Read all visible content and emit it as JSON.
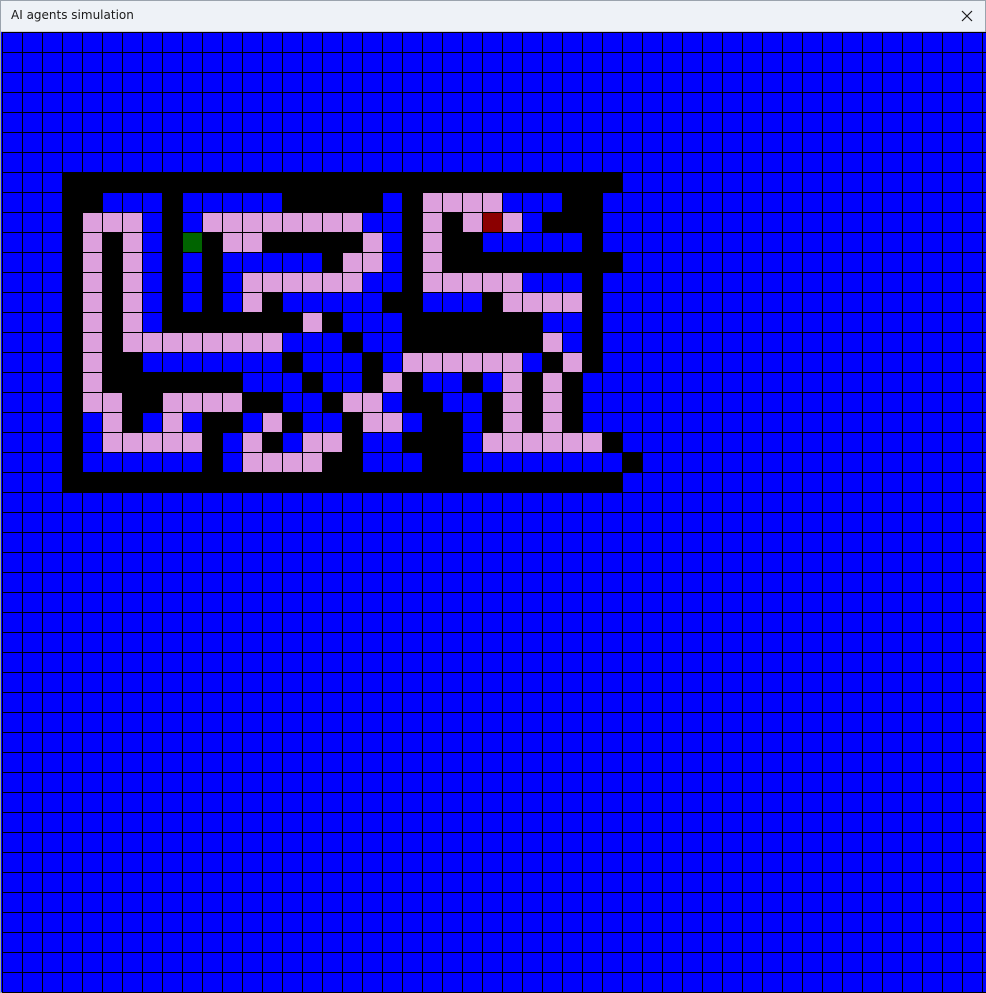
{
  "window": {
    "title": "AI agents simulation",
    "close_icon": "close-x-icon"
  },
  "colors": {
    "empty": "#0000ff",
    "wall": "#000000",
    "path": "#dda0dd",
    "start": "#006400",
    "goal": "#8b0000",
    "gridline": "#000000"
  },
  "maze": {
    "legend": {
      "#": "wall",
      ".": "empty",
      "p": "path",
      "S": "start",
      "G": "goal"
    },
    "rows": [
      "..................................................",
      "..................................................",
      "..................................................",
      "..................................................",
      "..................................................",
      "..................................................",
      "..................................................",
      "...############################...................",
      "...##...#.....#####.#pppp...##...................",
      "...#ppp.#.pppppppp..#p#pGp.###...................",
      "...#p#p.#S#pp#####p.#p##.....#...................",
      "...#p#p.#.#.....#pp.#p#########...................",
      "...#p#p.#.#.pppppp..#ppppp...#...................",
      "...#p#p.#.#.p#.....##...#pppp#...................",
      "...#p#p.#######p#...#######..#...................",
      "...#p#pppppppp...#..#######p.#...................",
      "...#p##.......#...#.pppppp.#p#...................",
      "...#p#######...#..#p#..#.p#p#...................",
      "...#pp##pppp##..#pp.##..#p#p#...................",
      "...#.p#.p.##.p#..#pp.##.#p#p#...................",
      "...#.ppppp#.p#.pp#..###.pppppp#...................",
      "...#......#.pppp##...##........#...................",
      "...############################...................",
      "..................................................",
      "..................................................",
      "..................................................",
      "..................................................",
      "..................................................",
      "..................................................",
      "..................................................",
      "..................................................",
      "..................................................",
      "..................................................",
      "..................................................",
      "..................................................",
      "..................................................",
      "..................................................",
      "..................................................",
      "..................................................",
      "..................................................",
      "..................................................",
      "..................................................",
      "..................................................",
      "..................................................",
      "..................................................",
      "..................................................",
      "..................................................",
      "..................................................",
      ".................................................."
    ]
  }
}
